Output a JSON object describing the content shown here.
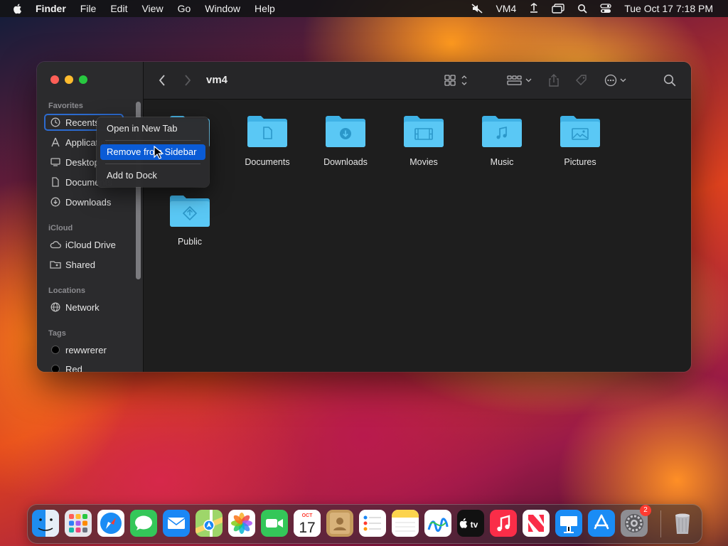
{
  "menubar": {
    "app_name": "Finder",
    "items": [
      "File",
      "Edit",
      "View",
      "Go",
      "Window",
      "Help"
    ],
    "status_text": "VM4",
    "datetime": "Tue Oct 17  7:18 PM"
  },
  "window": {
    "title": "vm4",
    "sidebar": {
      "favorites_heading": "Favorites",
      "favorites": [
        {
          "label": "Recents",
          "icon": "clock-icon"
        },
        {
          "label": "Applications",
          "icon": "applications-icon"
        },
        {
          "label": "Desktop",
          "icon": "desktop-icon"
        },
        {
          "label": "Documents",
          "icon": "document-icon"
        },
        {
          "label": "Downloads",
          "icon": "download-icon"
        }
      ],
      "icloud_heading": "iCloud",
      "icloud": [
        {
          "label": "iCloud Drive",
          "icon": "cloud-icon"
        },
        {
          "label": "Shared",
          "icon": "shared-folder-icon"
        }
      ],
      "locations_heading": "Locations",
      "locations": [
        {
          "label": "Network",
          "icon": "globe-icon"
        }
      ],
      "tags_heading": "Tags",
      "tags": [
        {
          "label": "rewwrerer",
          "color": "#000000"
        },
        {
          "label": "Red",
          "color": "#000000"
        }
      ]
    },
    "folders": [
      {
        "label": "Documents",
        "glyph": "document-glyph"
      },
      {
        "label": "Downloads",
        "glyph": "download-glyph"
      },
      {
        "label": "Movies",
        "glyph": "film-glyph"
      },
      {
        "label": "Music",
        "glyph": "music-note-glyph"
      },
      {
        "label": "Pictures",
        "glyph": "photo-glyph"
      },
      {
        "label": "Public",
        "glyph": "public-glyph"
      }
    ]
  },
  "context_menu": {
    "items": [
      "Open in New Tab",
      "Remove from Sidebar",
      "Add to Dock"
    ],
    "highlighted": "Remove from Sidebar"
  },
  "dock": {
    "apps": [
      "Finder",
      "Launchpad",
      "Safari",
      "Messages",
      "Mail",
      "Maps",
      "Photos",
      "FaceTime",
      "Calendar",
      "Contacts",
      "Reminders",
      "Notes",
      "Freeform",
      "TV",
      "Music",
      "News",
      "Keynote",
      "App Store",
      "System Settings",
      "Trash"
    ],
    "calendar_month": "OCT",
    "calendar_day": "17",
    "tv_label": "tv",
    "system_settings_badge": "2"
  },
  "colors": {
    "folder_blue": "#5ac8f5",
    "folder_blue_dark": "#3fb2e6",
    "selection_blue": "#0a5bd6",
    "focus_ring": "#2c6bcf"
  }
}
